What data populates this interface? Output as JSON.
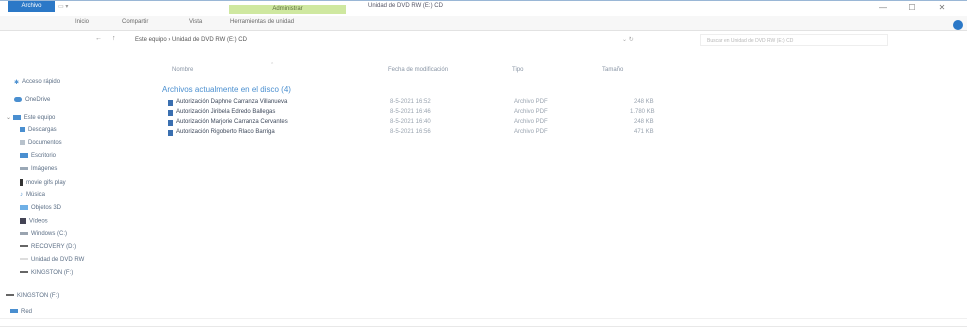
{
  "window": {
    "title": "Unidad de DVD RW (E:) CD",
    "contextual_tab": "Administrar",
    "controls": {
      "minimize": "—",
      "maximize": "☐",
      "close": "✕"
    }
  },
  "ribbon": {
    "tabs": [
      "Archivo",
      "Inicio",
      "Compartir",
      "Vista",
      "Herramientas de unidad"
    ]
  },
  "address": {
    "breadcrumbs": [
      "Este equipo",
      "Unidad de DVD RW (E:) CD"
    ],
    "search_placeholder": "Buscar en Unidad de DVD RW (E:) CD"
  },
  "nav_pane": {
    "items": [
      {
        "label": "Acceso rápido",
        "icon": "star-icon",
        "color": "#4a8fd0"
      },
      {
        "label": "OneDrive",
        "icon": "cloud-icon",
        "color": "#4a8fd0"
      },
      {
        "label": "Este equipo",
        "icon": "computer-icon",
        "color": "#4a8fd0"
      },
      {
        "label": "Descargas",
        "icon": "download-icon",
        "color": "#4a8fd0"
      },
      {
        "label": "Documentos",
        "icon": "document-icon",
        "color": "#8a96a6"
      },
      {
        "label": "Escritorio",
        "icon": "desktop-icon",
        "color": "#4a8fd0"
      },
      {
        "label": "Imágenes",
        "icon": "image-icon",
        "color": "#8a96a6"
      },
      {
        "label": "movie gifs play",
        "icon": "phone-icon",
        "color": "#555555"
      },
      {
        "label": "Música",
        "icon": "music-icon",
        "color": "#4a8fd0"
      },
      {
        "label": "Objetos 3D",
        "icon": "cube-icon",
        "color": "#4a8fd0"
      },
      {
        "label": "Vídeos",
        "icon": "video-icon",
        "color": "#555555"
      },
      {
        "label": "Windows (C:)",
        "icon": "drive-icon",
        "color": "#8a96a6"
      },
      {
        "label": "RECOVERY (D:)",
        "icon": "drive-icon",
        "color": "#555555"
      },
      {
        "label": "Unidad de DVD RW",
        "icon": "dvd-icon",
        "color": "#cccccc"
      },
      {
        "label": "KINGSTON (F:)",
        "icon": "usb-icon",
        "color": "#555555"
      },
      {
        "label": "KINGSTON (F:)",
        "icon": "usb-icon",
        "color": "#555555"
      },
      {
        "label": "Red",
        "icon": "network-icon",
        "color": "#4a8fd0"
      }
    ]
  },
  "columns": {
    "name": "Nombre",
    "date": "Fecha de modificación",
    "type": "Tipo",
    "size": "Tamaño"
  },
  "group": {
    "header": "Archivos actualmente en el disco (4)"
  },
  "files": [
    {
      "name": "Autorización Daphne Carranza Villanueva",
      "date": "8-5-2021 16:52",
      "type": "Archivo PDF",
      "size": "248 KB"
    },
    {
      "name": "Autorización Jiribela Edredo Ballegas",
      "date": "8-5-2021 16:46",
      "type": "Archivo PDF",
      "size": "1.780 KB"
    },
    {
      "name": "Autorización Marjorie Carranza Cervantes",
      "date": "8-5-2021 16:40",
      "type": "Archivo PDF",
      "size": "248 KB"
    },
    {
      "name": "Autorización Rigoberto Rlaco Barriga",
      "date": "8-5-2021 16:56",
      "type": "Archivo PDF",
      "size": "471 KB"
    }
  ]
}
